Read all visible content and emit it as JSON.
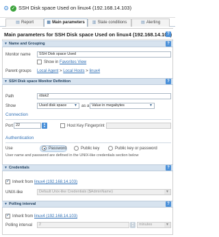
{
  "window": {
    "title": "SSH Disk space Used on linux4 (192.168.14.103)"
  },
  "tabs": [
    {
      "label": "Report",
      "active": false
    },
    {
      "label": "Main parameters",
      "active": true
    },
    {
      "label": "State conditions",
      "active": false
    },
    {
      "label": "Alerting",
      "active": false
    }
  ],
  "main": {
    "heading": "Main parameters for SSH Disk space Used on linux4 (192.168.14.103)"
  },
  "naming": {
    "section_title": "Name and Grouping",
    "monitor_name_label": "Monitor name",
    "monitor_name_value": "SSH Disk space Used",
    "show_in_label": "Show in",
    "favorites_link": "Favorites View",
    "parent_groups_label": "Parent groups",
    "breadcrumb": [
      "Local Agent",
      ">",
      "Local Hosts",
      ">",
      "linux4"
    ]
  },
  "definition": {
    "section_title": "SSH Disk space Monitor Definition",
    "path_label": "Path",
    "path_value": "/disk2",
    "show_label": "Show",
    "show_value": "Used disk space",
    "as_label": "as a",
    "as_value": "Value in megabytes"
  },
  "connection": {
    "title": "Connection",
    "port_label": "Port",
    "port_value": "22",
    "host_key_label": "Host Key Fingerprint",
    "host_key_value": ""
  },
  "auth": {
    "title": "Authentication",
    "use_label": "Use",
    "options": [
      "Password",
      "Public key",
      "Public key or password"
    ],
    "selected": "Password",
    "note": "User name and password are defined in the UNIX-like credentials section below"
  },
  "credentials": {
    "section_title": "Credentials",
    "inherit_label": "Inherit from",
    "inherit_link": "linux4 (192.168.14.103)",
    "unix_label": "UNIX-like",
    "unix_value": "Default Unix-like Credentials ($AdminName)"
  },
  "polling": {
    "section_title": "Polling interval",
    "inherit_label": "Inherit from",
    "inherit_link": "linux4 (192.168.14.103)",
    "interval_label": "Polling interval",
    "interval_value": "2",
    "unit_value": "minutes"
  },
  "colors": {
    "accent": "#4a90d9",
    "section_bg": "#d7e3ef",
    "link": "#2f6fb5",
    "ok": "#3ca33c"
  },
  "icons": [
    "gear-icon",
    "ok-status-icon",
    "report-tab-icon",
    "main-params-tab-icon",
    "state-tab-icon",
    "alert-tab-icon",
    "help-icon",
    "caret-down-icon",
    "checkbox-icon",
    "spinner-icon",
    "chevron-down-icon"
  ]
}
